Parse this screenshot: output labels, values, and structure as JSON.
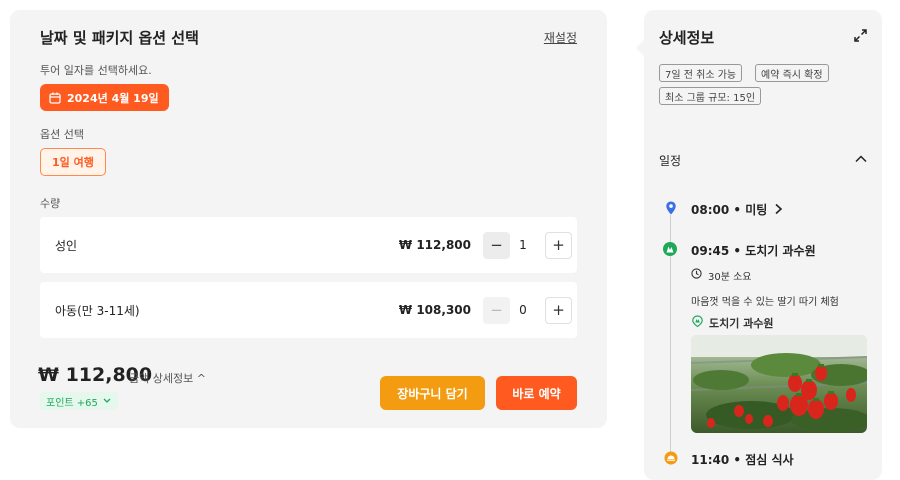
{
  "booking": {
    "title": "날짜 및 패키지 옵션 선택",
    "reset_label": "재설정",
    "date_label": "투어 일자를 선택하세요.",
    "selected_date": "2024년 4월 19일",
    "option_label": "옵션 선택",
    "selected_option": "1일 여행",
    "quantity_label": "수량",
    "rows": [
      {
        "name": "성인",
        "price": "₩ 112,800",
        "quantity": "1"
      },
      {
        "name": "아동(만 3-11세)",
        "price": "₩ 108,300",
        "quantity": "0"
      }
    ],
    "total": "₩ 112,800",
    "price_detail_label": "금액 상세정보 ^",
    "points_label": "포인트 +65",
    "add_to_cart_label": "장바구니 담기",
    "book_now_label": "바로 예약"
  },
  "details": {
    "title": "상세정보",
    "tags": [
      "7일 전 취소 가능",
      "예약 즉시 확정",
      "최소 그룹 규모: 15인"
    ],
    "itinerary_label": "일정",
    "timeline": [
      {
        "time_title": "08:00 • 미팅",
        "icon": "location-pin-icon"
      },
      {
        "time_title": "09:45 • 도치기 과수원",
        "icon": "landmark-icon",
        "duration": "30분 소요",
        "description": "마음껏 먹을 수 있는 딸기 따기 체험",
        "place": "도치기 과수원"
      },
      {
        "time_title": "11:40 • 점심 식사",
        "icon": "meal-icon"
      }
    ]
  },
  "colors": {
    "accent": "#ff5a1f",
    "cart": "#f39c12",
    "points": "#1fa85a",
    "pin": "#3b6fe8"
  }
}
